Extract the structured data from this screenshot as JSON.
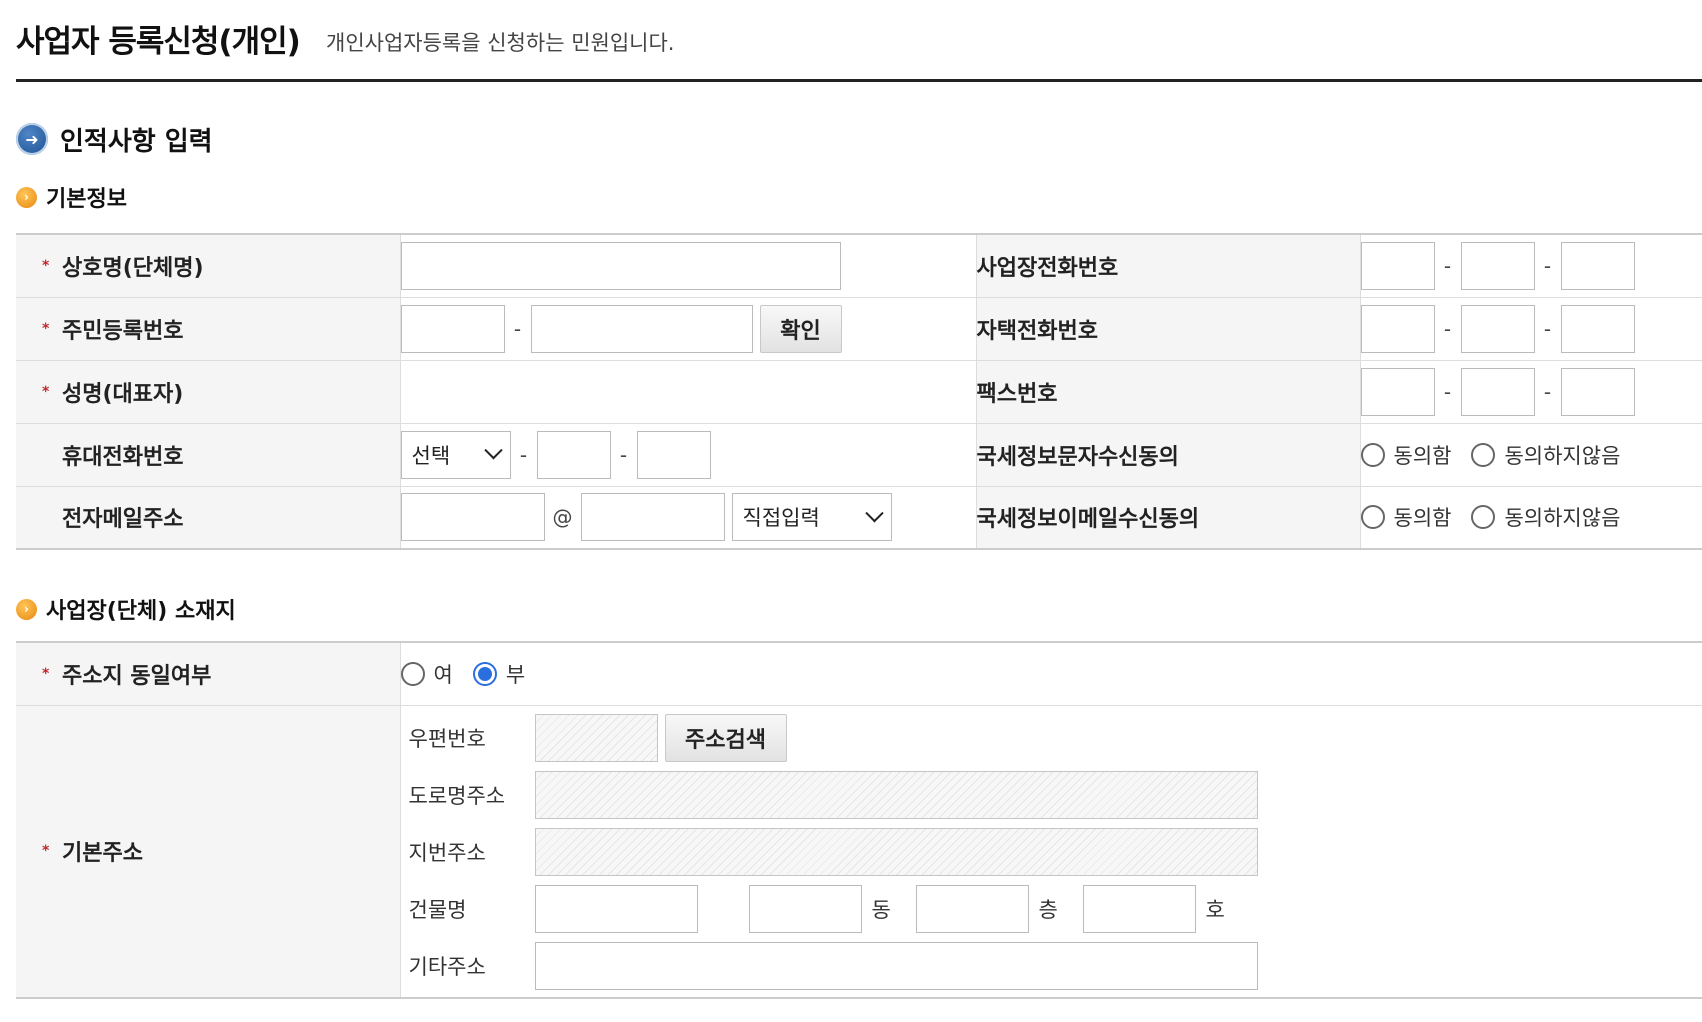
{
  "header": {
    "title": "사업자 등록신청(개인)",
    "description": "개인사업자등록을 신청하는 민원입니다."
  },
  "section": {
    "title": "인적사항 입력",
    "icon": "arrow-right-circle-icon"
  },
  "basic_info": {
    "title": "기본정보",
    "company_name_label": "상호명(단체명)",
    "resident_number_label": "주민등록번호",
    "confirm_button": "확인",
    "name_label": "성명(대표자)",
    "mobile_label": "휴대전화번호",
    "mobile_prefix_selected": "선택",
    "email_label": "전자메일주소",
    "email_at": "@",
    "email_domain_selected": "직접입력",
    "business_phone_label": "사업장전화번호",
    "home_phone_label": "자택전화번호",
    "fax_label": "팩스번호",
    "sms_consent_label": "국세정보문자수신동의",
    "email_consent_label": "국세정보이메일수신동의",
    "agree": "동의함",
    "disagree": "동의하지않음",
    "dash": "-"
  },
  "location": {
    "title": "사업장(단체) 소재지",
    "same_address_label": "주소지 동일여부",
    "yes": "여",
    "no": "부",
    "selected": "부",
    "basic_address_label": "기본주소",
    "zip_label": "우편번호",
    "search_button": "주소검색",
    "road_address_label": "도로명주소",
    "lot_address_label": "지번주소",
    "building_label": "건물명",
    "dong": "동",
    "floor": "층",
    "ho": "호",
    "other_address_label": "기타주소"
  },
  "required_mark": "*"
}
